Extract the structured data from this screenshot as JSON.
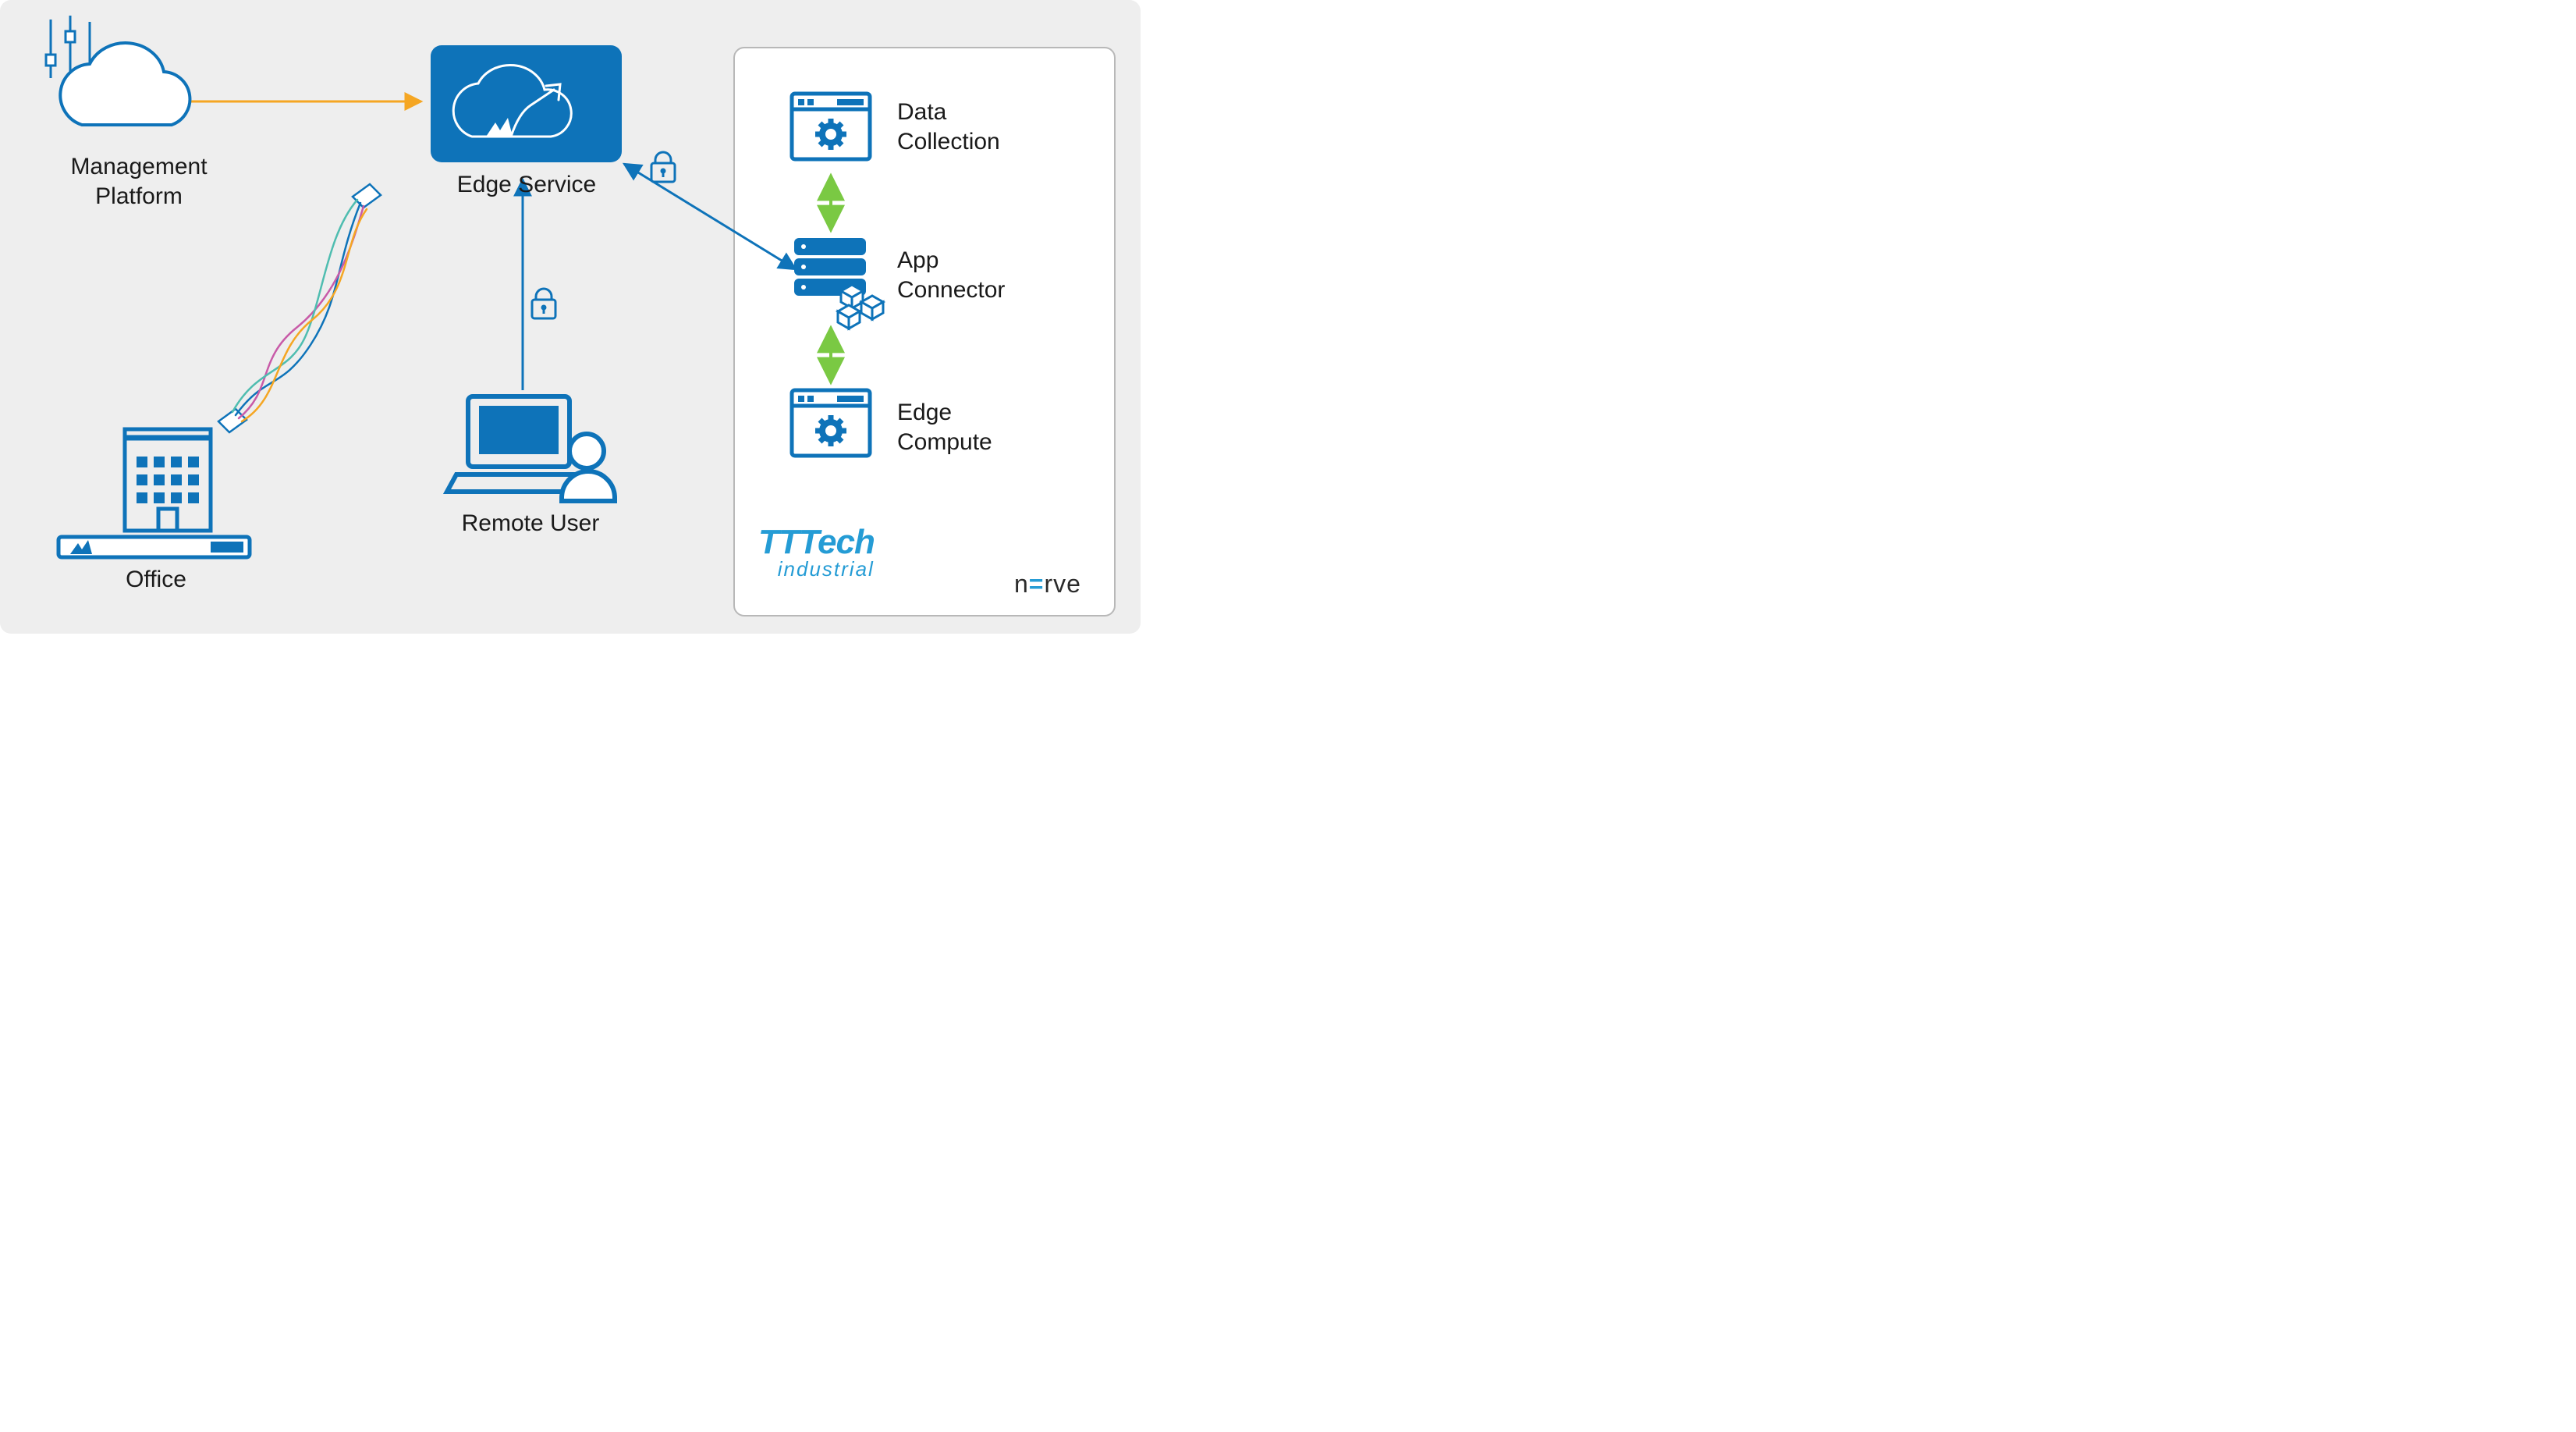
{
  "nodes": {
    "management_platform": "Management\nPlatform",
    "edge_service": "Edge Service",
    "office": "Office",
    "remote_user": "Remote User"
  },
  "panel": {
    "data_collection": "Data\nCollection",
    "app_connector": "App\nConnector",
    "edge_compute": "Edge\nCompute"
  },
  "logos": {
    "tttech_main": "TTTech",
    "tttech_sub": "industrial",
    "nerve": "n=rve",
    "nerve_pre": "n",
    "nerve_accent": "=",
    "nerve_post": "rve"
  },
  "colors": {
    "primary_blue": "#0E73B9",
    "accent_blue": "#259CD5",
    "orange": "#F5A623",
    "green": "#7AC943",
    "magenta": "#C85BA8",
    "teal": "#4FBDB0"
  }
}
